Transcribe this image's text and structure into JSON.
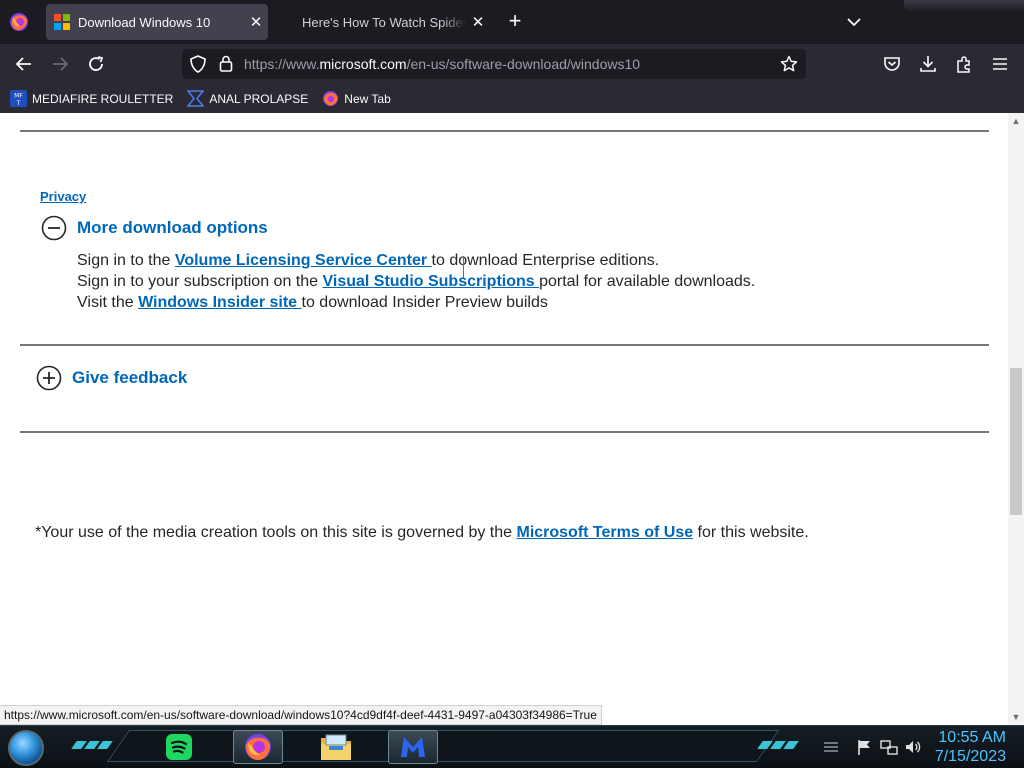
{
  "browser": {
    "tabs": [
      {
        "title": "Download Windows 10",
        "active": true,
        "close": "✕"
      },
      {
        "title": "Here's How To Watch Spider-M",
        "active": false,
        "close": "✕"
      }
    ],
    "new_tab": "+",
    "url": {
      "prefix": "https://www.",
      "domain": "microsoft.com",
      "path": "/en-us/software-download/windows10"
    },
    "bookmarks": [
      {
        "label": "MEDIAFIRE ROULETTER",
        "icon": "mediafire-icon"
      },
      {
        "label": "ANAL PROLAPSE",
        "icon": "bookmark-link-icon"
      },
      {
        "label": "New Tab",
        "icon": "firefox-icon"
      }
    ]
  },
  "page": {
    "privacy_link": "Privacy",
    "more_options": {
      "heading": "More download options",
      "lines": [
        {
          "before": "Sign in to the ",
          "link": "Volume Licensing Service Center ",
          "after": "to download Enterprise editions."
        },
        {
          "before": "Sign in to your subscription on the ",
          "link": "Visual Studio Subscriptions ",
          "after": "portal for available downloads."
        },
        {
          "before": "Visit the ",
          "link": "Windows Insider site ",
          "after": "to download Insider Preview builds"
        }
      ]
    },
    "feedback": {
      "heading": "Give feedback"
    },
    "terms": {
      "before": "*Your use of the media creation tools on this site is governed by the ",
      "link": "Microsoft Terms of Use",
      "after": " for this website."
    }
  },
  "status_url": "https://www.microsoft.com/en-us/software-download/windows10?4cd9df4f-deef-4431-9497-a04303f34986=True",
  "taskbar": {
    "apps": [
      "spotify-icon",
      "firefox-icon",
      "file-explorer-icon",
      "malwarebytes-icon"
    ],
    "clock": {
      "time": "10:55 AM",
      "date": "7/15/2023"
    }
  },
  "colors": {
    "link": "#0067b8",
    "tabstrip": "#1c1b22",
    "toolbar": "#2b2a33",
    "clock": "#4fc3ff"
  }
}
